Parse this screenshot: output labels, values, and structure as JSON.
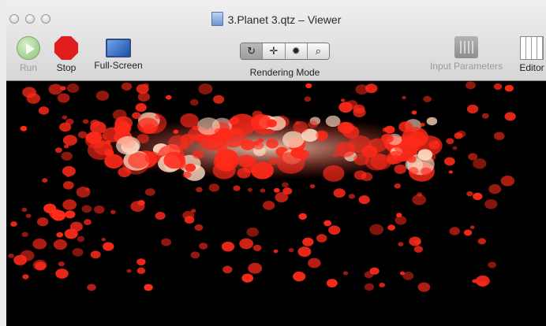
{
  "window": {
    "title": "3.Planet 3.qtz – Viewer"
  },
  "toolbar": {
    "run_label": "Run",
    "stop_label": "Stop",
    "fullscreen_label": "Full-Screen",
    "rendering_mode_label": "Rendering Mode",
    "rendering_modes": [
      "↻",
      "✛",
      "✹",
      "⌕"
    ],
    "input_parameters_label": "Input Parameters",
    "editor_label": "Editor"
  },
  "viewer": {
    "particle_color": "#ff2a1a",
    "core_color": "#ffd8c0",
    "background": "#000000"
  }
}
